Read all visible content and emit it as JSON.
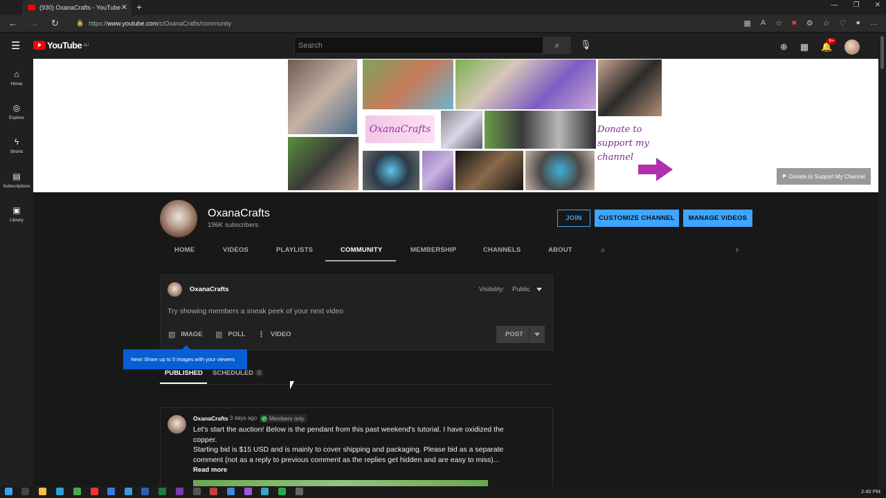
{
  "browser": {
    "tab_title": "(930) OxanaCrafts - YouTube",
    "url_prefix": "https://",
    "url_host": "www.youtube.com",
    "url_path": "/c/OxanaCrafts/community"
  },
  "header": {
    "logo_text": "YouTube",
    "region": "AU",
    "search_placeholder": "Search",
    "notification_count": "9+"
  },
  "leftnav": {
    "items": [
      {
        "label": "Home",
        "icon": "home-icon"
      },
      {
        "label": "Explore",
        "icon": "compass-icon"
      },
      {
        "label": "Shorts",
        "icon": "shorts-icon"
      },
      {
        "label": "Subscriptions",
        "icon": "subscriptions-icon"
      },
      {
        "label": "Library",
        "icon": "library-icon"
      }
    ]
  },
  "banner": {
    "logo_text": "OxanaCrafts",
    "donate_lines": [
      "Donate to",
      "support my",
      "channel"
    ],
    "donate_button": "Donate to Support My Channel"
  },
  "channel": {
    "name": "OxanaCrafts",
    "subscribers": "196K subscribers",
    "join_label": "JOIN",
    "customize_label": "CUSTOMIZE CHANNEL",
    "manage_label": "MANAGE VIDEOS",
    "tabs": [
      "HOME",
      "VIDEOS",
      "PLAYLISTS",
      "COMMUNITY",
      "MEMBERSHIP",
      "CHANNELS",
      "ABOUT"
    ],
    "active_tab": "COMMUNITY"
  },
  "composer": {
    "author": "OxanaCrafts",
    "visibility_label": "Visibility:",
    "visibility_value": "Public",
    "prompt": "Try showing members a sneak peek of your next video",
    "image_label": "IMAGE",
    "poll_label": "POLL",
    "video_label": "VIDEO",
    "post_label": "POST",
    "tooltip": "New! Share up to 5 images with your viewers"
  },
  "subtabs": {
    "published": "PUBLISHED",
    "scheduled": "SCHEDULED",
    "scheduled_count": "0"
  },
  "post": {
    "author": "OxanaCrafts",
    "time": "3 days ago",
    "badge": "Members only",
    "lines": [
      "Let's start the auction! Below is the pendant from this past weekend's tutorial. I have oxidized the",
      "copper.",
      "Starting bid is $15 USD and is mainly to cover shipping and packaging. Please bid as a separate",
      "comment (not as a reply to previous comment as the replies get hidden and are easy to miss)..."
    ],
    "read_more": "Read more"
  },
  "taskbar": {
    "clock": "2:40 PM"
  },
  "colors": {
    "accent": "#3ea6ff",
    "brand_red": "#ff0000",
    "tooltip_blue": "#065fd4",
    "member_green": "#2ba640"
  }
}
